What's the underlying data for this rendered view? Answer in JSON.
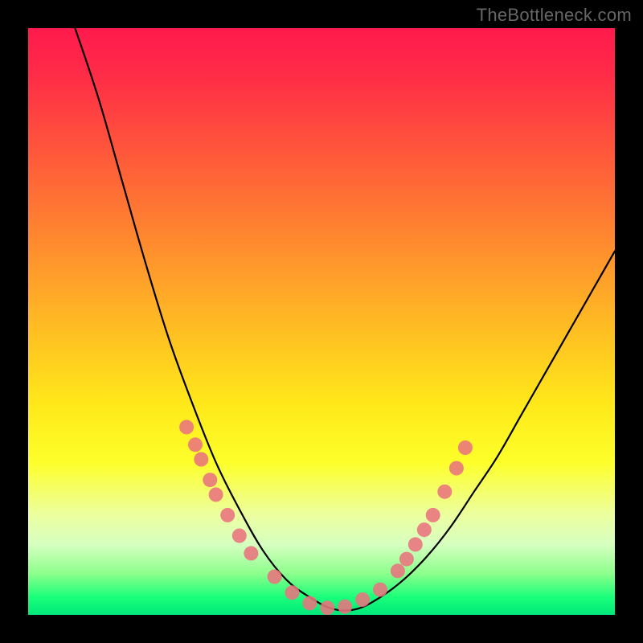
{
  "watermark": "TheBottleneck.com",
  "chart_data": {
    "type": "line",
    "title": "",
    "xlabel": "",
    "ylabel": "",
    "xlim": [
      0,
      100
    ],
    "ylim": [
      0,
      100
    ],
    "annotations": [
      "vertical rainbow gradient background (red top to green bottom)"
    ],
    "series": [
      {
        "name": "bottleneck-curve",
        "x": [
          8,
          12,
          16,
          20,
          24,
          28,
          32,
          36,
          40,
          44,
          48,
          52,
          56,
          60,
          64,
          68,
          72,
          76,
          80,
          84,
          88,
          92,
          96,
          100
        ],
        "y": [
          100,
          88,
          74,
          60,
          47,
          36,
          26,
          18,
          11,
          6,
          3,
          1,
          1,
          3,
          6,
          10,
          15,
          21,
          27,
          34,
          41,
          48,
          55,
          62
        ]
      }
    ],
    "marker_clusters": [
      {
        "name": "left-cluster",
        "points_xy": [
          [
            27,
            32
          ],
          [
            28.5,
            29
          ],
          [
            29.5,
            26.5
          ],
          [
            31,
            23
          ],
          [
            32,
            20.5
          ],
          [
            34,
            17
          ],
          [
            36,
            13.5
          ],
          [
            38,
            10.5
          ]
        ]
      },
      {
        "name": "bottom-cluster",
        "points_xy": [
          [
            42,
            6.5
          ],
          [
            45,
            3.8
          ],
          [
            48,
            2.0
          ],
          [
            51,
            1.2
          ],
          [
            54,
            1.4
          ],
          [
            57,
            2.6
          ],
          [
            60,
            4.3
          ]
        ]
      },
      {
        "name": "right-cluster",
        "points_xy": [
          [
            63,
            7.5
          ],
          [
            64.5,
            9.5
          ],
          [
            66,
            12
          ],
          [
            67.5,
            14.5
          ],
          [
            69,
            17
          ],
          [
            71,
            21
          ],
          [
            73,
            25
          ],
          [
            74.5,
            28.5
          ]
        ]
      }
    ],
    "marker_color": "#e9737e",
    "curve_color": "#000000",
    "gradient_stops": [
      {
        "pos": 0,
        "color": "#ff1a4d"
      },
      {
        "pos": 22,
        "color": "#ff5a3a"
      },
      {
        "pos": 52,
        "color": "#ffc022"
      },
      {
        "pos": 74,
        "color": "#fdff2a"
      },
      {
        "pos": 93,
        "color": "#8cff8c"
      },
      {
        "pos": 100,
        "color": "#00e87a"
      }
    ]
  }
}
